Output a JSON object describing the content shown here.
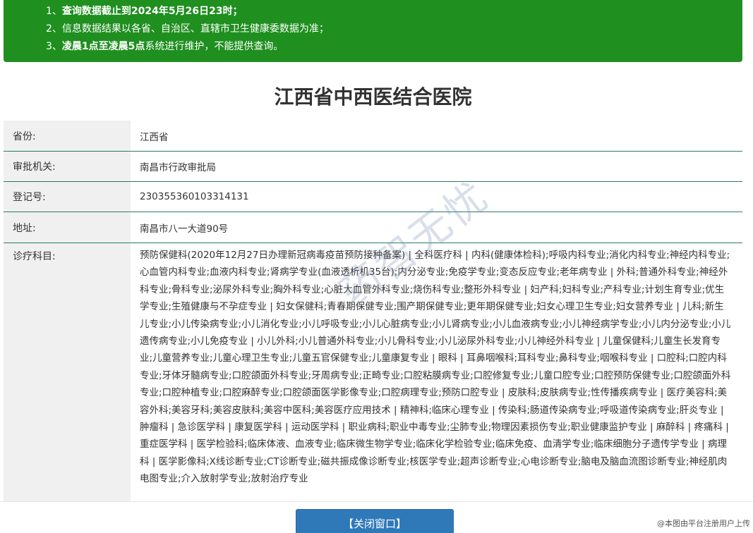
{
  "notice": {
    "line1_prefix": "1、",
    "line1_bold": "查询数据截止到2024年5月26日23时；",
    "line2": "2、信息数据结果以各省、自治区、直辖市卫生健康委数据为准；",
    "line3_prefix": "3、",
    "line3_bold": "凌晨1点至凌晨5点",
    "line3_suffix": "系统进行维护，不能提供查询。"
  },
  "hospital": {
    "name": "江西省中西医结合医院"
  },
  "fields": [
    {
      "label": "省份:",
      "value": "江西省"
    },
    {
      "label": "审批机关:",
      "value": "南昌市行政审批局"
    },
    {
      "label": "登记号:",
      "value": "230355360103314131"
    },
    {
      "label": "地址:",
      "value": "南昌市八一大道90号"
    },
    {
      "label": "诊疗科目:",
      "value": "预防保健科(2020年12月27日办理新冠病毒疫苗预防接种备案) | 全科医疗科 | 内科(健康体检科);呼吸内科专业;消化内科专业;神经内科专业;心血管内科专业;血液内科专业;肾病学专业(血液透析机35台);内分泌专业;免疫学专业;变态反应专业;老年病专业 | 外科;普通外科专业;神经外科专业;骨科专业;泌尿外科专业;胸外科专业;心脏大血管外科专业;烧伤科专业;整形外科专业 | 妇产科;妇科专业;产科专业;计划生育专业;优生学专业;生殖健康与不孕症专业 | 妇女保健科;青春期保健专业;围产期保健专业;更年期保健专业;妇女心理卫生专业;妇女营养专业 | 儿科;新生儿专业;小儿传染病专业;小儿消化专业;小儿呼吸专业;小儿心脏病专业;小儿肾病专业;小儿血液病专业;小儿神经病学专业;小儿内分泌专业;小儿遗传病专业;小儿免疫专业 | 小儿外科;小儿普通外科专业;小儿骨科专业;小儿泌尿外科专业;小儿神经外科专业 | 儿童保健科;儿童生长发育专业;儿童营养专业;儿童心理卫生专业;儿童五官保健专业;儿童康复专业 | 眼科 | 耳鼻咽喉科;耳科专业;鼻科专业;咽喉科专业 | 口腔科;口腔内科专业;牙体牙髓病专业;口腔颌面外科专业;牙周病专业;正畸专业;口腔粘膜病专业;口腔修复专业;儿童口腔专业;口腔预防保健专业;口腔颌面外科专业;口腔种植专业;口腔麻醉专业;口腔颌面医学影像专业;口腔病理专业;预防口腔专业 | 皮肤科;皮肤病专业;性传播疾病专业 | 医疗美容科;美容外科;美容牙科;美容皮肤科;美容中医科;美容医疗应用技术 | 精神科;临床心理专业 | 传染科;肠道传染病专业;呼吸道传染病专业;肝炎专业 | 肿瘤科 | 急诊医学科 | 康复医学科 | 运动医学科 | 职业病科;职业中毒专业;尘肺专业;物理因素损伤专业;职业健康监护专业 | 麻醉科 | 疼痛科 | 重症医学科 | 医学检验科;临床体液、血液专业;临床微生物学专业;临床化学检验专业;临床免疫、血清学专业;临床细胞分子遗传学专业 | 病理科 | 医学影像科;X线诊断专业;CT诊断专业;磁共振成像诊断专业;核医学专业;超声诊断专业;心电诊断专业;脑电及脑血流图诊断专业;神经肌肉电图专业;介入放射学专业;放射治疗专业"
    }
  ],
  "watermark": "药智无忧",
  "footer": {
    "close_label": "【关闭窗口】",
    "credit": "@本图由平台注册用户上传"
  }
}
